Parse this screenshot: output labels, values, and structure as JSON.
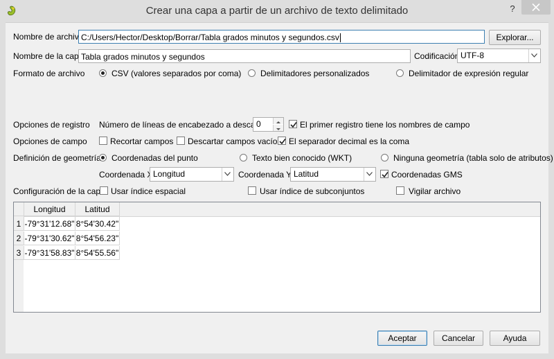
{
  "window": {
    "title": "Crear una capa a partir de un archivo de texto delimitado",
    "help_glyph": "?"
  },
  "file": {
    "label": "Nombre de archivo",
    "value": "C:/Users/Hector/Desktop/Borrar/Tabla grados minutos y segundos.csv",
    "browse_label": "Explorar..."
  },
  "layer": {
    "label": "Nombre de la capa",
    "value": "Tabla grados minutos y segundos",
    "encoding_label": "Codificación",
    "encoding_value": "UTF-8"
  },
  "format": {
    "label": "Formato de archivo",
    "options": [
      {
        "label": "CSV (valores separados por coma)",
        "selected": true
      },
      {
        "label": "Delimitadores personalizados",
        "selected": false
      },
      {
        "label": "Delimitador de expresión regular",
        "selected": false
      }
    ]
  },
  "record": {
    "label": "Opciones de registro",
    "skip_label": "Número de líneas de encabezado a descartar",
    "skip_value": "0",
    "first_record_label": "El primer registro tiene los nombres de campo",
    "first_record_checked": true
  },
  "field": {
    "label": "Opciones de campo",
    "options": [
      {
        "label": "Recortar campos",
        "checked": false
      },
      {
        "label": "Descartar campos vacíos",
        "checked": false
      },
      {
        "label": "El separador decimal es la coma",
        "checked": true
      }
    ]
  },
  "geometry": {
    "label": "Definición de geometría",
    "options": [
      {
        "label": "Coordenadas del punto",
        "selected": true
      },
      {
        "label": "Texto bien conocido (WKT)",
        "selected": false
      },
      {
        "label": "Ninguna geometría (tabla solo de atributos)",
        "selected": false
      }
    ],
    "x_label": "Coordenada X",
    "x_value": "Longitud",
    "y_label": "Coordenada Y",
    "y_value": "Latitud",
    "dms_label": "Coordenadas GMS",
    "dms_checked": true
  },
  "layer_settings": {
    "label": "Configuración de la capa",
    "options": [
      {
        "label": "Usar índice espacial",
        "checked": false
      },
      {
        "label": "Usar índice de subconjuntos",
        "checked": false
      },
      {
        "label": "Vigilar archivo",
        "checked": false
      }
    ]
  },
  "table": {
    "columns": [
      "Longitud",
      "Latitud"
    ],
    "rows": [
      {
        "num": "1",
        "cells": [
          "-79°31'12.68\"",
          "8°54'30.42\""
        ]
      },
      {
        "num": "2",
        "cells": [
          "-79°31'30.62\"",
          "8°54'56.23\""
        ]
      },
      {
        "num": "3",
        "cells": [
          "-79°31'58.83\"",
          "8°54'55.56\""
        ]
      }
    ]
  },
  "buttons": {
    "ok": "Aceptar",
    "cancel": "Cancelar",
    "help": "Ayuda"
  },
  "colors": {
    "accent": "#3c7fb1",
    "check": "#222222"
  }
}
